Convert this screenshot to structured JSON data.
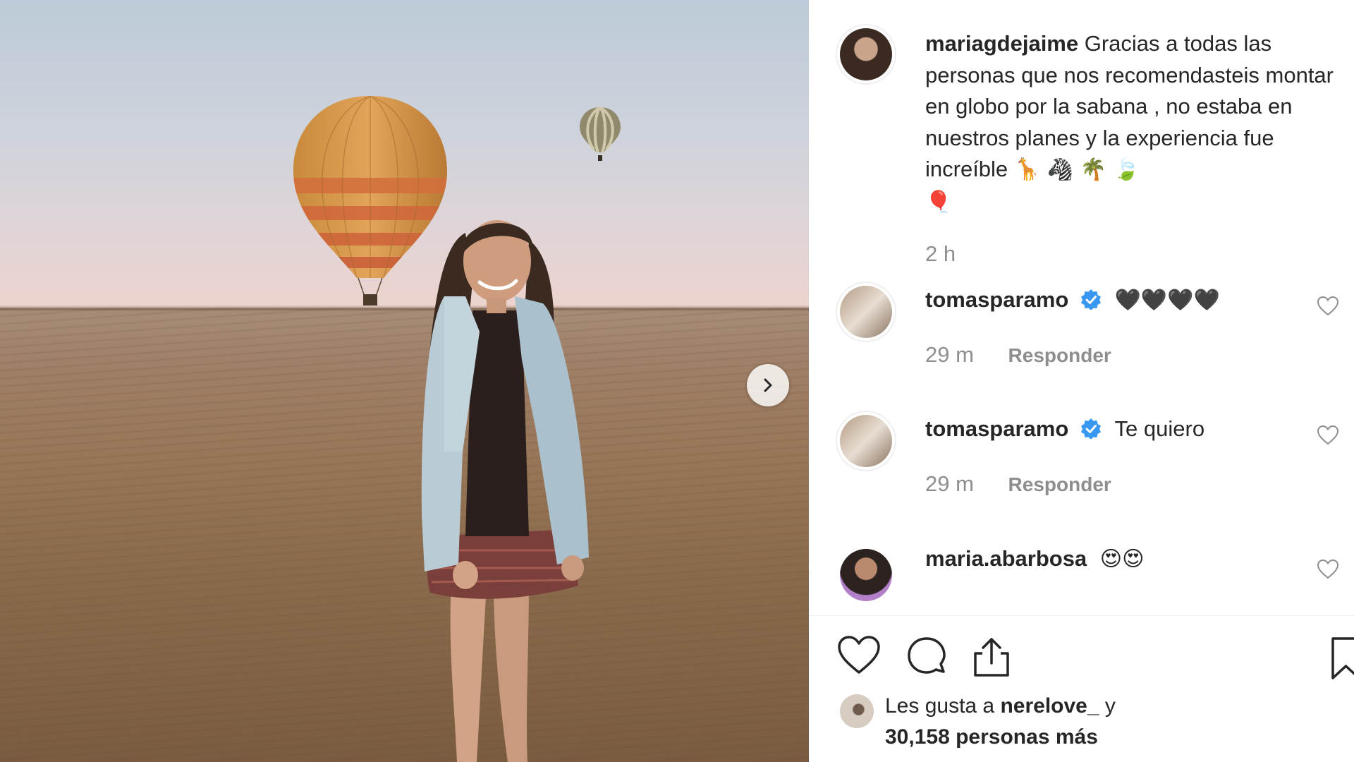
{
  "post": {
    "next_arrow_icon": "chevron-right-icon"
  },
  "caption": {
    "username": "mariagdejaime",
    "text": "Gracias a todas las personas que nos recomendasteis montar en globo por la sabana , no estaba en nuestros planes y la experiencia fue increíble",
    "emojis": "🦒 🦓 🌴 🍃",
    "emoji_line2": "🎈",
    "time": "2 h"
  },
  "comments": [
    {
      "username": "tomasparamo",
      "verified": true,
      "text": "🖤🖤🖤🖤",
      "time": "29 m",
      "reply": "Responder"
    },
    {
      "username": "tomasparamo",
      "verified": true,
      "text": "Te quiero",
      "time": "29 m",
      "reply": "Responder"
    },
    {
      "username": "maria.abarbosa",
      "verified": false,
      "text": "😍😍",
      "time": "",
      "reply": ""
    }
  ],
  "actions": {
    "like_icon": "heart-icon",
    "comment_icon": "comment-bubble-icon",
    "share_icon": "share-icon",
    "save_icon": "bookmark-icon"
  },
  "likes": {
    "prefix": "Les gusta a",
    "user": "nerelove_",
    "conj": "y",
    "count": "30,158",
    "suffix": "personas más"
  },
  "colors": {
    "verified": "#3897f0",
    "muted": "#8e8e8e",
    "text": "#262626"
  }
}
